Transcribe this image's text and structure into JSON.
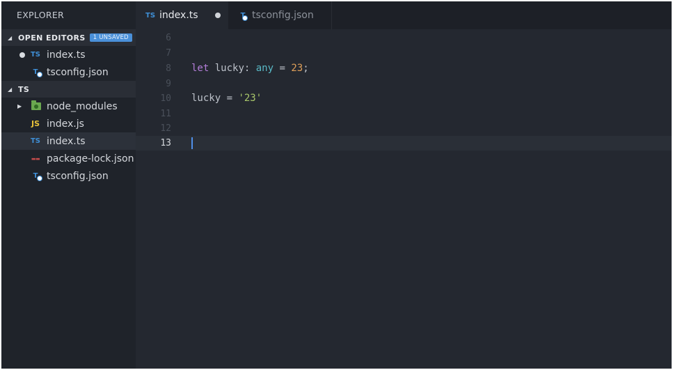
{
  "sidebar": {
    "title": "EXPLORER",
    "open_editors": {
      "label": "OPEN EDITORS",
      "badge": "1 UNSAVED",
      "items": [
        {
          "icon": "TS",
          "label": "index.ts",
          "unsaved": true
        },
        {
          "icon": "T",
          "label": "tsconfig.json"
        }
      ]
    },
    "folder": {
      "label": "TS",
      "items": [
        {
          "icon": "folder-icon",
          "label": "node_modules"
        },
        {
          "icon": "JS",
          "label": "index.js"
        },
        {
          "icon": "TS",
          "label": "index.ts",
          "selected": true
        },
        {
          "icon": "json",
          "label": "package-lock.json"
        },
        {
          "icon": "T",
          "label": "tsconfig.json"
        }
      ]
    }
  },
  "tabs": [
    {
      "icon": "TS",
      "label": "index.ts",
      "active": true,
      "unsaved": true
    },
    {
      "icon": "T",
      "label": "tsconfig.json",
      "active": false
    }
  ],
  "editor": {
    "current_line": "13",
    "lines": [
      {
        "n": "6"
      },
      {
        "n": "7"
      },
      {
        "n": "8",
        "tokens": [
          "let",
          " lucky: ",
          "any",
          " = ",
          "23",
          ";"
        ]
      },
      {
        "n": "9"
      },
      {
        "n": "10",
        "tokens": [
          "lucky = ",
          "'23'"
        ]
      },
      {
        "n": "11"
      },
      {
        "n": "12"
      },
      {
        "n": "13"
      }
    ]
  },
  "colors": {
    "keyword": "#b47ed9",
    "type": "#59b9c6",
    "number": "#e0a05a",
    "string": "#a9c76b",
    "badge": "#4a90d9"
  }
}
